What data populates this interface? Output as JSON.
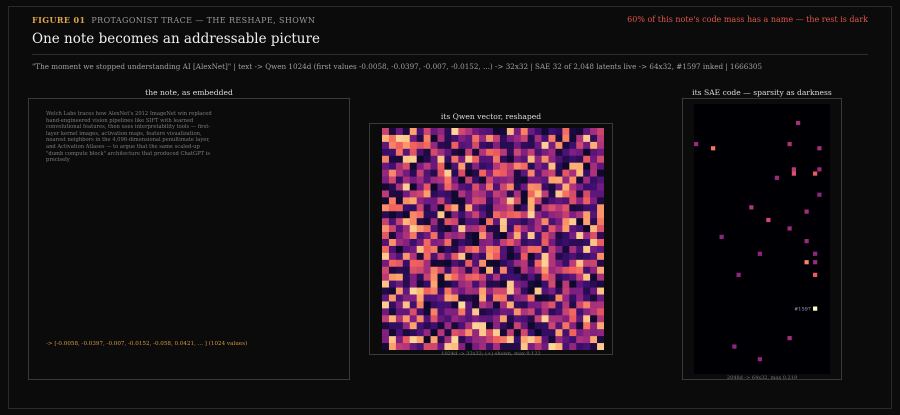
{
  "header": {
    "figure_number": "FIGURE 01",
    "figure_subtitle": "PROTAGONIST TRACE — THE RESHAPE, SHOWN",
    "right_note": "60% of this note's code mass has a name — the rest is dark",
    "title": "One note becomes an addressable picture",
    "caption": "\"The moment we stopped understanding AI [AlexNet]\" | text -> Qwen 1024d (first values -0.0058, -0.0397, -0.007, -0.0152, ...) -> 32x32 | SAE 32 of 2,048 latents live -> 64x32, #1597 inked | 1666305"
  },
  "panels": {
    "note": {
      "title": "the note, as embedded",
      "body": "Welch Labs traces how AlexNet's 2012 ImageNet win replaced hand-engineered vision pipelines like SIFT with learned convolutional features, then uses interpretability tools — first-layer kernel images, activation maps, feature visualization, nearest neighbors in the 4,096-dimensional penultimate layer, and Activation Atlases — to argue that the same scaled-up \"dumb compute block\" architecture that produced ChatGPT is precisely",
      "vector_preview": "-> [-0.0058, -0.0397, -0.007, -0.0152, -0.058, 0.0421, ... ]  (1024 values)"
    },
    "qwen": {
      "title": "its Qwen vector, reshaped",
      "footer": "1024d -> 32x32; (+) shown, max 0.122"
    },
    "sae": {
      "title": "its SAE code — sparsity as darkness",
      "footer": "2048d -> 64x32, max 0.219",
      "highlight_label": "#1597"
    }
  },
  "colors": {
    "accent_orange": "#e0a64a",
    "warning_red": "#e0564a",
    "magma_low": "#0d0829",
    "magma_high": "#fcfdbf"
  },
  "chart_data": [
    {
      "type": "heatmap",
      "name": "qwen_vector_reshaped",
      "rows": 32,
      "cols": 32,
      "value_max": 0.122,
      "colormap": "magma",
      "note": "1024 embedding values shown as 32x32 grid, positive values only"
    },
    {
      "type": "heatmap",
      "name": "sae_code",
      "rows": 64,
      "cols": 32,
      "value_max": 0.219,
      "colormap": "magma",
      "active_latents": [
        {
          "row": 9,
          "col": 0,
          "value": 0.06
        },
        {
          "row": 10,
          "col": 4,
          "value": 0.15
        },
        {
          "row": 4,
          "col": 24,
          "value": 0.07
        },
        {
          "row": 9,
          "col": 22,
          "value": 0.08
        },
        {
          "row": 10,
          "col": 29,
          "value": 0.07
        },
        {
          "row": 15,
          "col": 23,
          "value": 0.09
        },
        {
          "row": 17,
          "col": 19,
          "value": 0.06
        },
        {
          "row": 16,
          "col": 23,
          "value": 0.12
        },
        {
          "row": 15,
          "col": 29,
          "value": 0.06
        },
        {
          "row": 16,
          "col": 28,
          "value": 0.13
        },
        {
          "row": 21,
          "col": 29,
          "value": 0.05
        },
        {
          "row": 24,
          "col": 13,
          "value": 0.08
        },
        {
          "row": 27,
          "col": 17,
          "value": 0.11
        },
        {
          "row": 29,
          "col": 22,
          "value": 0.06
        },
        {
          "row": 25,
          "col": 26,
          "value": 0.07
        },
        {
          "row": 31,
          "col": 6,
          "value": 0.05
        },
        {
          "row": 32,
          "col": 26,
          "value": 0.06
        },
        {
          "row": 35,
          "col": 15,
          "value": 0.05
        },
        {
          "row": 35,
          "col": 28,
          "value": 0.05
        },
        {
          "row": 37,
          "col": 26,
          "value": 0.16
        },
        {
          "row": 37,
          "col": 28,
          "value": 0.06
        },
        {
          "row": 40,
          "col": 28,
          "value": 0.13
        },
        {
          "row": 40,
          "col": 10,
          "value": 0.05
        },
        {
          "row": 48,
          "col": 28,
          "value": 0.219
        },
        {
          "row": 55,
          "col": 22,
          "value": 0.07
        },
        {
          "row": 57,
          "col": 9,
          "value": 0.05
        },
        {
          "row": 60,
          "col": 15,
          "value": 0.05
        }
      ]
    }
  ]
}
